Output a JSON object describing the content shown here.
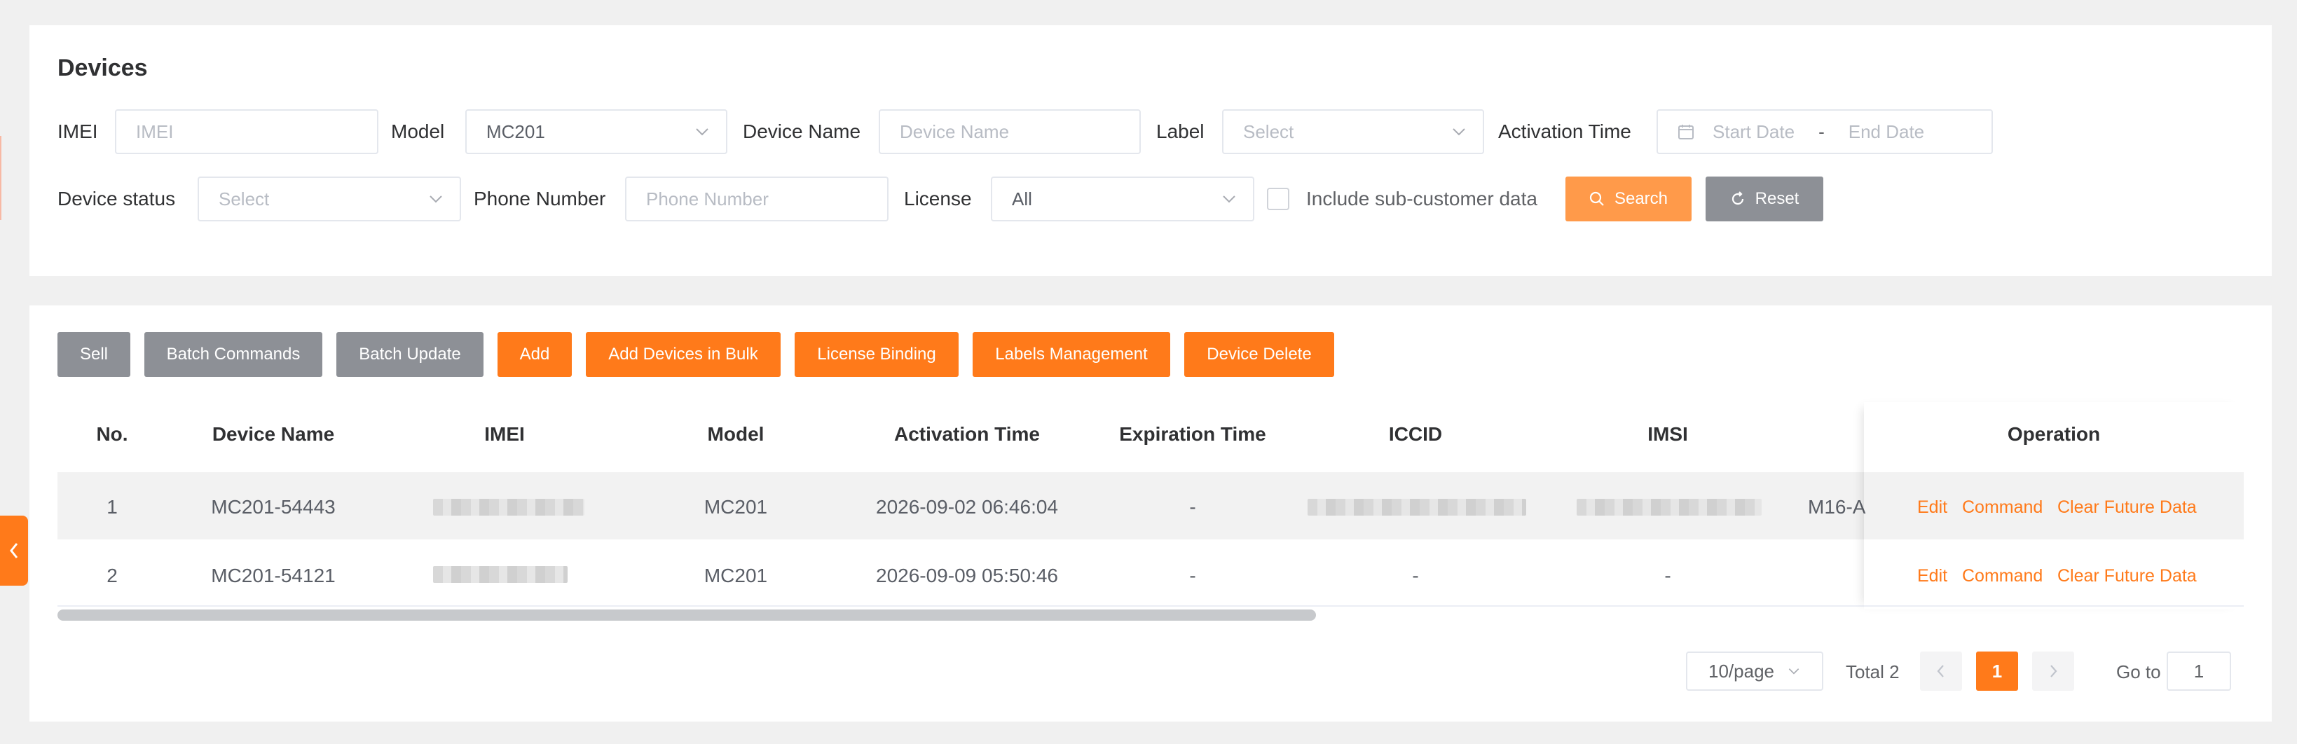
{
  "page": {
    "title": "Devices"
  },
  "filters": {
    "imei": {
      "label": "IMEI",
      "placeholder": "IMEI"
    },
    "model": {
      "label": "Model",
      "value": "MC201"
    },
    "device_name": {
      "label": "Device Name",
      "placeholder": "Device Name"
    },
    "label": {
      "label": "Label",
      "placeholder": "Select"
    },
    "activation_time": {
      "label": "Activation Time",
      "start_placeholder": "Start Date",
      "separator": "-",
      "end_placeholder": "End Date"
    },
    "device_status": {
      "label": "Device status",
      "placeholder": "Select"
    },
    "phone_number": {
      "label": "Phone Number",
      "placeholder": "Phone Number"
    },
    "license": {
      "label": "License",
      "value": "All"
    },
    "include_sub": {
      "label": "Include sub-customer data",
      "checked": false
    },
    "search_label": "Search",
    "reset_label": "Reset"
  },
  "toolbar": {
    "sell": "Sell",
    "batch_commands": "Batch Commands",
    "batch_update": "Batch Update",
    "add": "Add",
    "add_bulk": "Add Devices in Bulk",
    "license_binding": "License Binding",
    "labels_management": "Labels Management",
    "device_delete": "Device Delete"
  },
  "table": {
    "headers": {
      "no": "No.",
      "device_name": "Device Name",
      "imei": "IMEI",
      "model": "Model",
      "activation_time": "Activation Time",
      "expiration_time": "Expiration Time",
      "iccid": "ICCID",
      "imsi": "IMSI",
      "operation": "Operation"
    },
    "rows": [
      {
        "no": "1",
        "device_name": "MC201-54443",
        "model": "MC201",
        "activation_time": "2026-09-02 06:46:04",
        "expiration_time": "-",
        "iccid": "",
        "imsi": "",
        "extra": "M16-A"
      },
      {
        "no": "2",
        "device_name": "MC201-54121",
        "model": "MC201",
        "activation_time": "2026-09-09 05:50:46",
        "expiration_time": "-",
        "iccid": "-",
        "imsi": "-",
        "extra": ""
      }
    ],
    "operations": {
      "edit": "Edit",
      "command": "Command",
      "clear": "Clear Future Data"
    }
  },
  "pagination": {
    "page_size": "10/page",
    "total": "Total 2",
    "current_page": "1",
    "goto_label": "Go to",
    "goto_value": "1"
  },
  "colors": {
    "accent": "#ff7a1a",
    "gray_button": "#8d9096"
  },
  "icons": [
    "chevron-down-icon",
    "calendar-icon",
    "search-icon",
    "reset-icon",
    "chevron-left-icon",
    "chevron-right-icon",
    "side-collapse-icon"
  ]
}
